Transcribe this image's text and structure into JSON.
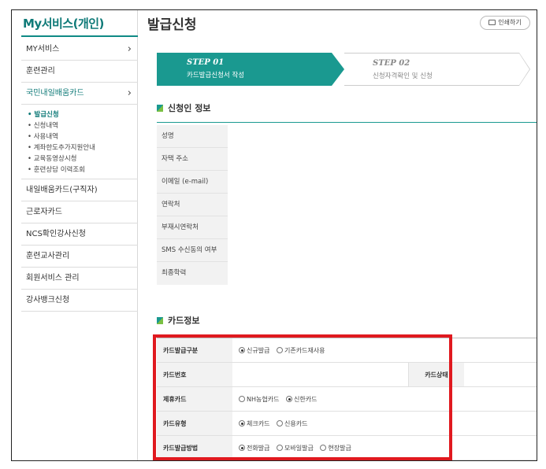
{
  "sidebar": {
    "title": "My서비스(개인)",
    "items": [
      {
        "label": "MY서비스",
        "chevron": true
      },
      {
        "label": "훈련관리",
        "chevron": false
      },
      {
        "label": "국민내일배움카드",
        "chevron": true,
        "active": true
      }
    ],
    "subitems": [
      {
        "label": "• 발급신청",
        "active": true
      },
      {
        "label": "• 신청내역"
      },
      {
        "label": "• 사용내역"
      },
      {
        "label": "• 계좌한도추가지원안내"
      },
      {
        "label": "• 교육동영상시청"
      },
      {
        "label": "• 훈련상담 이력조회"
      }
    ],
    "items_after": [
      {
        "label": "내일배움카드(구직자)"
      },
      {
        "label": "근로자카드"
      },
      {
        "label": "NCS확인강사신청"
      },
      {
        "label": "훈련교사관리"
      },
      {
        "label": "회원서비스 관리"
      },
      {
        "label": "강사뱅크신청"
      }
    ]
  },
  "main": {
    "page_title": "발급신청",
    "print_label": "인쇄하기",
    "steps": [
      {
        "no": "STEP 01",
        "text": "카드발급신청서 작성"
      },
      {
        "no": "STEP 02",
        "text": "신청자격확인 및 신청"
      }
    ],
    "applicant_section": {
      "title": "신청인 정보",
      "rows": [
        "성명",
        "자택 주소",
        "이메일 (e-mail)",
        "연락처",
        "부재시연락처",
        "SMS 수신동의 여부",
        "최종학력"
      ]
    },
    "card_section": {
      "title": "카드정보",
      "rows": {
        "issue_type": {
          "label": "카드발급구분",
          "options": [
            "신규발급",
            "기존카드재사용"
          ],
          "selected": 0
        },
        "card_number": {
          "label": "카드번호",
          "status_label": "카드상태"
        },
        "partner_card": {
          "label": "제휴카드",
          "options": [
            "NH농협카드",
            "신한카드"
          ],
          "selected": 1
        },
        "card_type": {
          "label": "카드유형",
          "options": [
            "체크카드",
            "신용카드"
          ],
          "selected": 0
        },
        "issue_method": {
          "label": "카드발급방법",
          "options": [
            "전화발급",
            "모바일발급",
            "현장발급"
          ],
          "selected": 0
        }
      }
    }
  },
  "colors": {
    "accent": "#1a9990",
    "highlight": "#e0191f"
  }
}
